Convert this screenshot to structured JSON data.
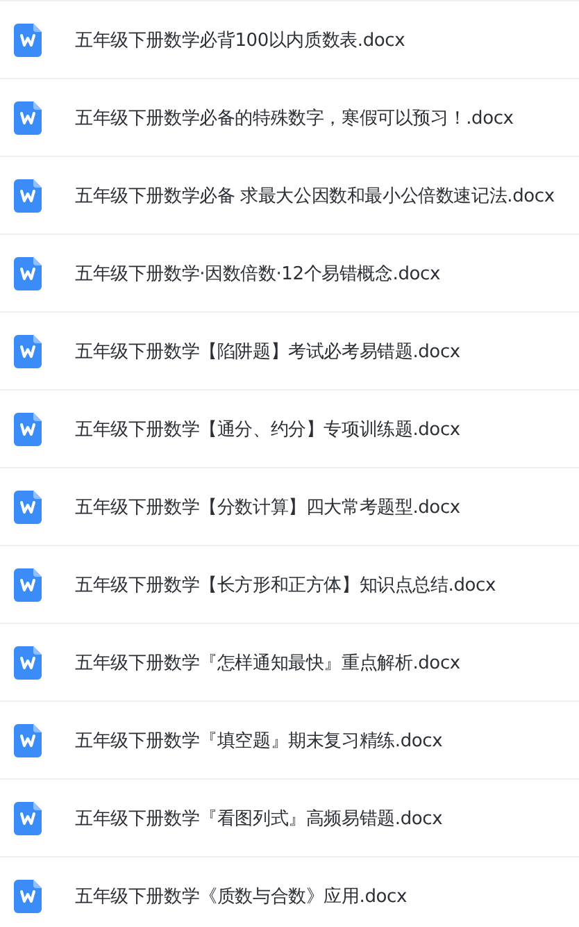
{
  "files": [
    {
      "name": "五年级下册数学必背100以内质数表.docx",
      "kind": "word"
    },
    {
      "name": "五年级下册数学必备的特殊数字，寒假可以预习！.docx",
      "kind": "word"
    },
    {
      "name": "五年级下册数学必备 求最大公因数和最小公倍数速记法.docx",
      "kind": "word"
    },
    {
      "name": "五年级下册数学·因数倍数·12个易错概念.docx",
      "kind": "word"
    },
    {
      "name": "五年级下册数学【陷阱题】考试必考易错题.docx",
      "kind": "word"
    },
    {
      "name": "五年级下册数学【通分、约分】专项训练题.docx",
      "kind": "word"
    },
    {
      "name": "五年级下册数学【分数计算】四大常考题型.docx",
      "kind": "word"
    },
    {
      "name": "五年级下册数学【长方形和正方体】知识点总结.docx",
      "kind": "word"
    },
    {
      "name": "五年级下册数学『怎样通知最快』重点解析.docx",
      "kind": "word"
    },
    {
      "name": "五年级下册数学『填空题』期末复习精练.docx",
      "kind": "word"
    },
    {
      "name": "五年级下册数学『看图列式』高频易错题.docx",
      "kind": "word"
    },
    {
      "name": "五年级下册数学《质数与合数》应用.docx",
      "kind": "word"
    }
  ]
}
